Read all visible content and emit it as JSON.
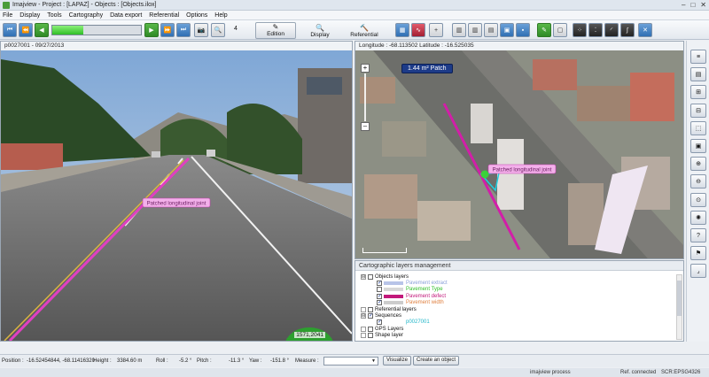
{
  "window": {
    "title": "Imajview - Project : [LAPAZ] - Objects : [Objects.ilox]",
    "controls": [
      "–",
      "□",
      "✕"
    ]
  },
  "menu": [
    "File",
    "Display",
    "Tools",
    "Cartography",
    "Data export",
    "Referential",
    "Options",
    "Help"
  ],
  "toolbar": {
    "progress_fraction": 0.35,
    "frame_step": "4",
    "modes": [
      {
        "label": "Edition",
        "icon": "edit-icon",
        "active": true
      },
      {
        "label": "Display",
        "icon": "magnifier-icon",
        "active": false
      },
      {
        "label": "Referential",
        "icon": "hammer-icon",
        "active": false
      }
    ]
  },
  "street_view": {
    "header": "p0027001 - 09/27/2013",
    "annotation": "Patched longitudinal joint",
    "counter": "1571,2041",
    "annotation_color": "#e040c0"
  },
  "map_view": {
    "header": "Longitude : -68.113502 Latitude : -16.525035",
    "patch_badge": "1.44 m² Patch",
    "annotation": "Patched longitudinal joint",
    "zoom_in": "+",
    "zoom_out": "–"
  },
  "layers": {
    "title": "Cartographic layers management",
    "items": [
      {
        "level": 0,
        "expander": "⊟",
        "checked": false,
        "label": "Objects layers",
        "color": "#111111"
      },
      {
        "level": 1,
        "checked": true,
        "label": "Pavement extract",
        "swatch": "#b8c4e8",
        "color": "#8aa0d8"
      },
      {
        "level": 1,
        "checked": false,
        "label": "Pavement Type",
        "swatch": "#d8d8d8",
        "color": "#2fbf27"
      },
      {
        "level": 1,
        "checked": true,
        "label": "Pavement defect",
        "swatch": "#c2187a",
        "color": "#c2187a"
      },
      {
        "level": 1,
        "checked": true,
        "label": "Pavement width",
        "swatch": "#cccccc",
        "color": "#e08040"
      },
      {
        "level": 0,
        "expander": "",
        "checked": false,
        "label": "Referential layers",
        "color": "#111111"
      },
      {
        "level": 0,
        "expander": "⊟",
        "checked": true,
        "label": "Sequences",
        "color": "#111111"
      },
      {
        "level": 1,
        "checked": true,
        "label": "p0027001",
        "swatch": "",
        "color": "#1fb5c8"
      },
      {
        "level": 0,
        "expander": "",
        "checked": false,
        "label": "GPS Layers",
        "color": "#111111"
      },
      {
        "level": 0,
        "expander": "",
        "checked": false,
        "label": "Shape layer",
        "color": "#111111"
      }
    ]
  },
  "right_tools": [
    "lane-icon",
    "layers-icon",
    "road-icon",
    "road-split-icon",
    "select-icon",
    "camera-icon",
    "zoom-in-icon",
    "zoom-out-icon",
    "zoom-fit-icon",
    "globe-icon",
    "help-icon",
    "flag-icon",
    "corner-icon"
  ],
  "status": {
    "position_label": "Position :",
    "position_value": "-16.52454844, -68.11416320",
    "height_label": "Height :",
    "height_value": "3384.60 m",
    "roll_label": "Roll :",
    "roll_value": "-5.2 °",
    "pitch_label": "Pitch :",
    "pitch_value": "-11.3 °",
    "yaw_label": "Yaw :",
    "yaw_value": "-151.8 °",
    "measure_label": "Measure :",
    "visualize": "Visualize",
    "create": "Create an object"
  },
  "footer": {
    "process": "imajview process",
    "connection": "Ref. connected",
    "srs": "SCR:EPSG4326"
  }
}
